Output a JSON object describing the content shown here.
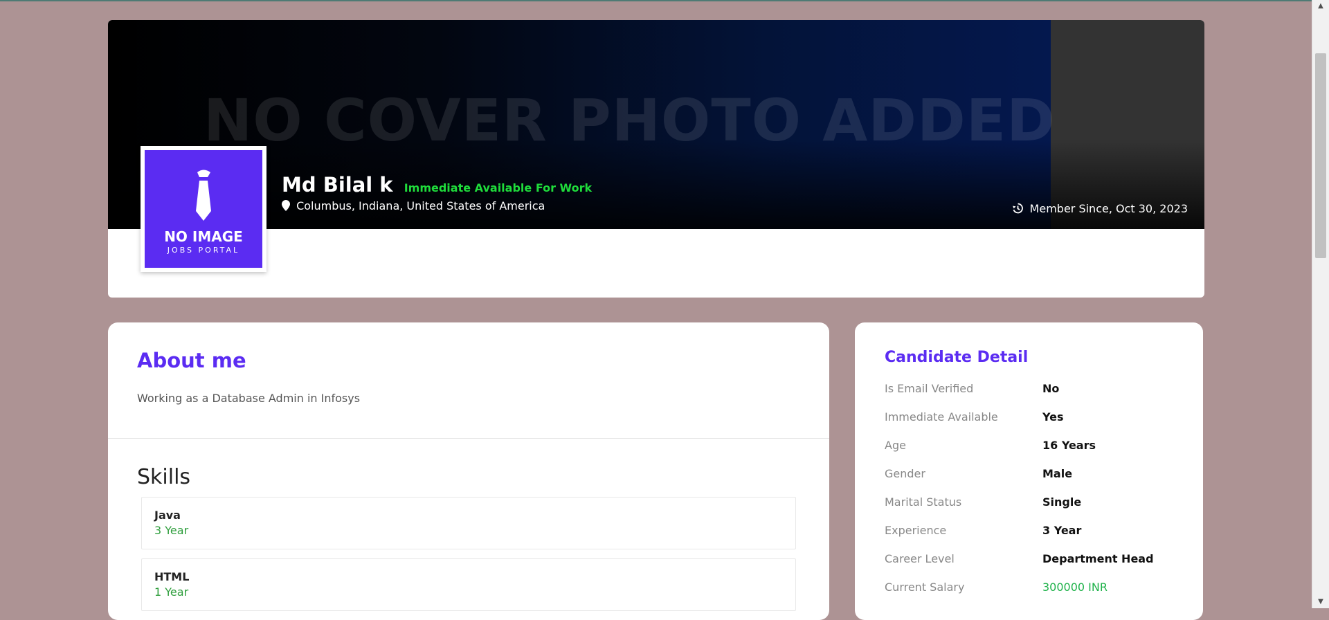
{
  "cover": {
    "text": "NO COVER PHOTO ADDED"
  },
  "avatar": {
    "title": "NO IMAGE",
    "subtitle": "JOBS PORTAL"
  },
  "profile": {
    "name": "Md Bilal k",
    "availability": "Immediate Available For Work",
    "location": "Columbus, Indiana, United States of America",
    "member_since": "Member Since, Oct 30, 2023"
  },
  "about": {
    "title": "About me",
    "text": "Working as a Database Admin in Infosys"
  },
  "skills": {
    "title": "Skills",
    "items": [
      {
        "name": "Java",
        "experience": "3 Year"
      },
      {
        "name": "HTML",
        "experience": "1 Year"
      }
    ]
  },
  "candidate_detail": {
    "title": "Candidate Detail",
    "rows": [
      {
        "label": "Is Email Verified",
        "value": "No"
      },
      {
        "label": "Immediate Available",
        "value": "Yes"
      },
      {
        "label": "Age",
        "value": "16 Years"
      },
      {
        "label": "Gender",
        "value": "Male"
      },
      {
        "label": "Marital Status",
        "value": "Single"
      },
      {
        "label": "Experience",
        "value": "3 Year"
      },
      {
        "label": "Career Level",
        "value": "Department Head"
      },
      {
        "label": "Current Salary",
        "value": "300000 INR"
      }
    ]
  },
  "colors": {
    "accent": "#5b2cf2",
    "available_green": "#1fdc3b",
    "salary_green": "#1fb24a",
    "page_background": "#ad9394"
  },
  "icons": [
    "map-pin-icon",
    "history-icon",
    "tie-icon"
  ]
}
